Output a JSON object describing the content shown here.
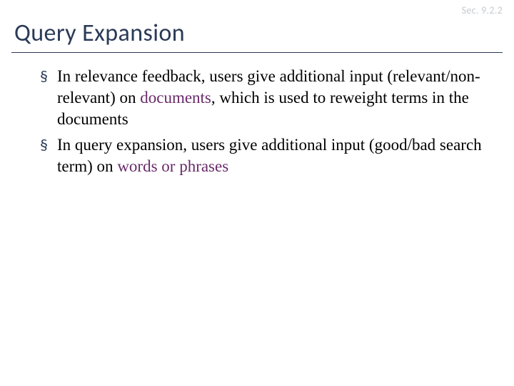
{
  "section_label": "Sec. 9.2.2",
  "title": "Query Expansion",
  "bullets": [
    {
      "pre": "In relevance feedback, users give additional input (relevant/non-relevant) on ",
      "accent": "documents",
      "post": ", which is used to reweight terms in the documents"
    },
    {
      "pre": "In query expansion, users give additional input (good/bad search term) on ",
      "accent": "words or phrases",
      "post": ""
    }
  ],
  "bullet_mark": "§"
}
